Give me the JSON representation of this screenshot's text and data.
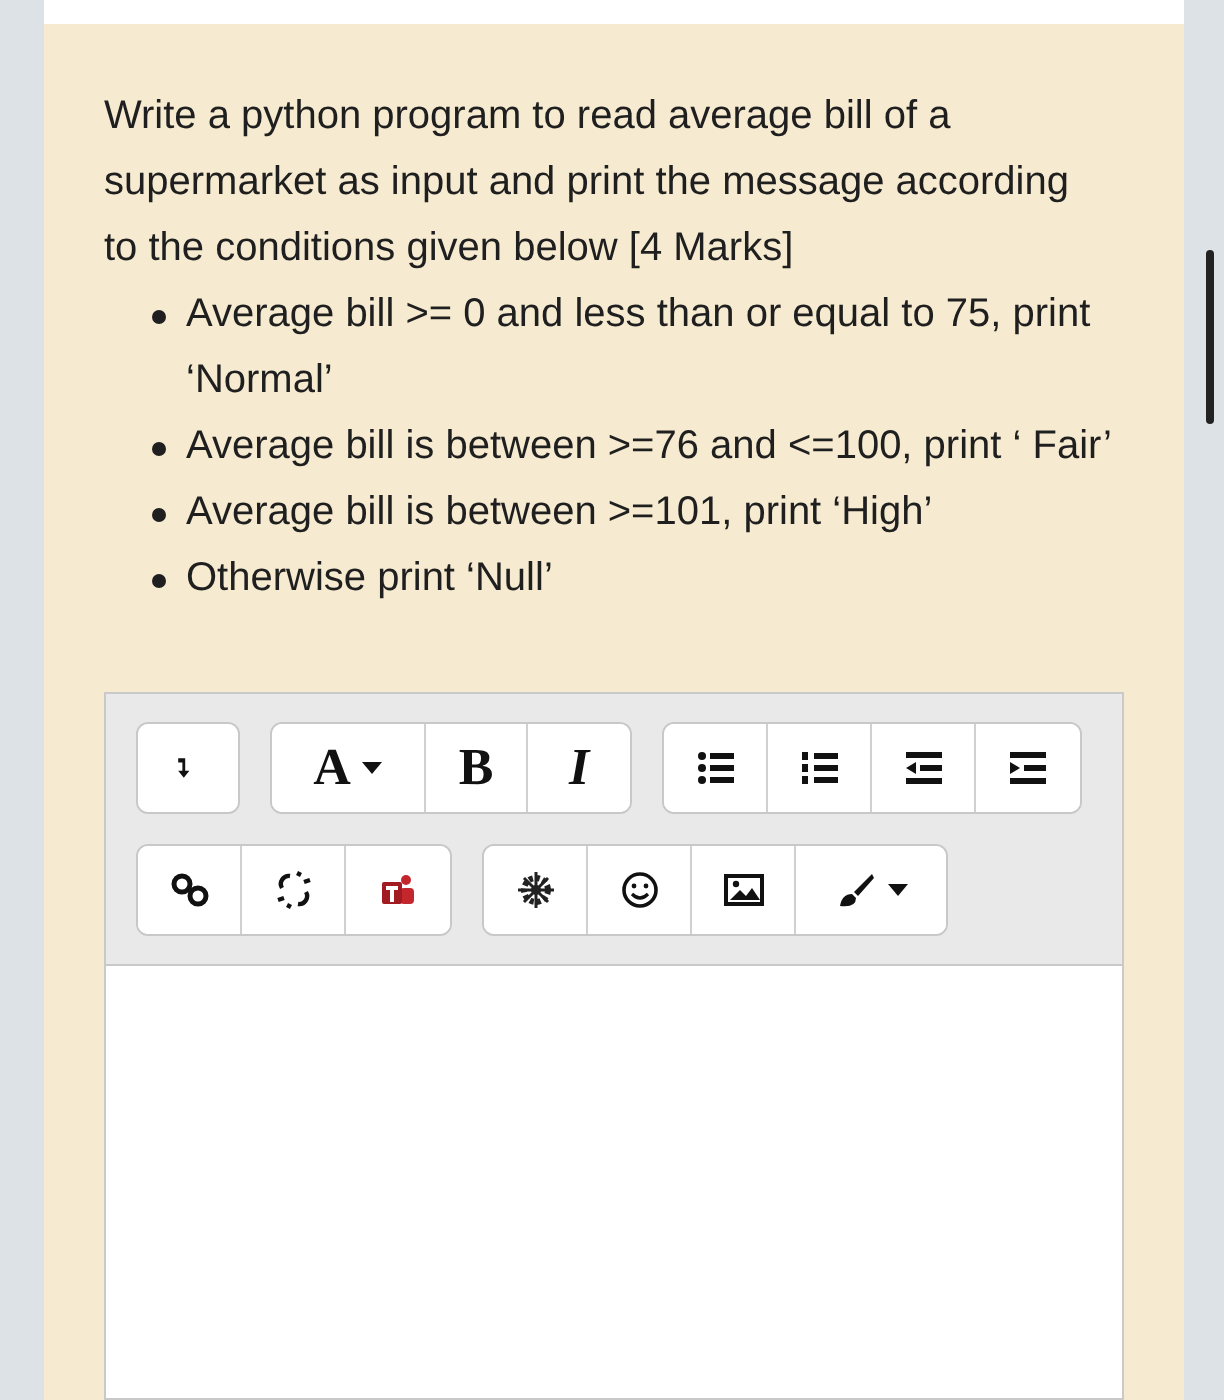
{
  "question": {
    "prompt": "Write a python program to read average bill of a supermarket as input and print the message according to the conditions given below [4 Marks]",
    "conditions": [
      "Average bill >= 0 and less than or equal to 75, print ‘Normal’",
      "Average bill is between >=76 and <=100, print ‘ Fair’",
      "Average bill is between >=101, print ‘High’",
      "Otherwise print ‘Null’"
    ]
  },
  "editor": {
    "toolbar_rows": [
      [
        [
          {
            "kind": "newline"
          }
        ],
        [
          {
            "kind": "font",
            "label": "A"
          },
          {
            "kind": "bold",
            "label": "B"
          },
          {
            "kind": "italic",
            "label": "I"
          }
        ],
        [
          {
            "kind": "bullets"
          },
          {
            "kind": "numbers"
          },
          {
            "kind": "outdent"
          },
          {
            "kind": "indent"
          }
        ]
      ],
      [
        [
          {
            "kind": "link"
          },
          {
            "kind": "unlink"
          },
          {
            "kind": "teams"
          }
        ],
        [
          {
            "kind": "wheel"
          },
          {
            "kind": "emoji"
          },
          {
            "kind": "image"
          },
          {
            "kind": "brush"
          }
        ]
      ]
    ]
  }
}
